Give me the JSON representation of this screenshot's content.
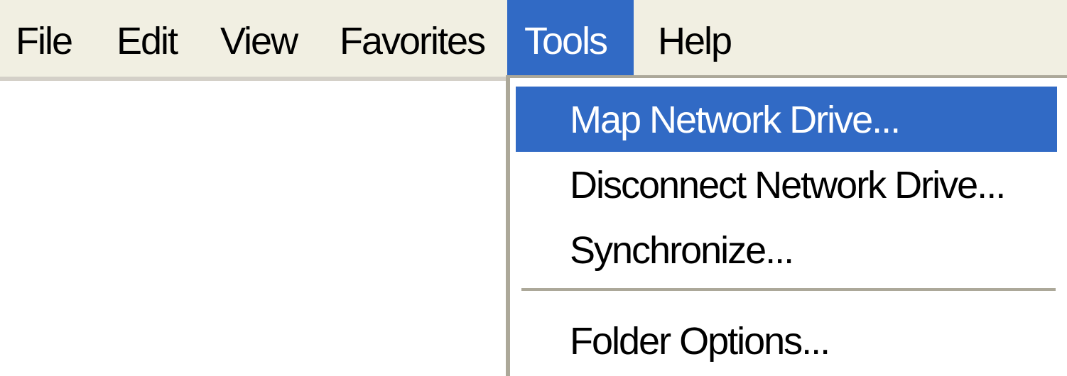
{
  "menubar": {
    "items": [
      {
        "label": "File"
      },
      {
        "label": "Edit"
      },
      {
        "label": "View"
      },
      {
        "label": "Favorites"
      },
      {
        "label": "Tools"
      },
      {
        "label": "Help"
      }
    ],
    "active": "Tools"
  },
  "tools_menu": {
    "items": [
      {
        "label": "Map Network Drive..."
      },
      {
        "label": "Disconnect Network Drive..."
      },
      {
        "label": "Synchronize..."
      },
      {
        "label": "Folder Options..."
      }
    ],
    "highlighted": "Map Network Drive..."
  },
  "colors": {
    "highlight": "#316ac5",
    "menubar_bg": "#f1efe2",
    "border": "#aca899"
  }
}
